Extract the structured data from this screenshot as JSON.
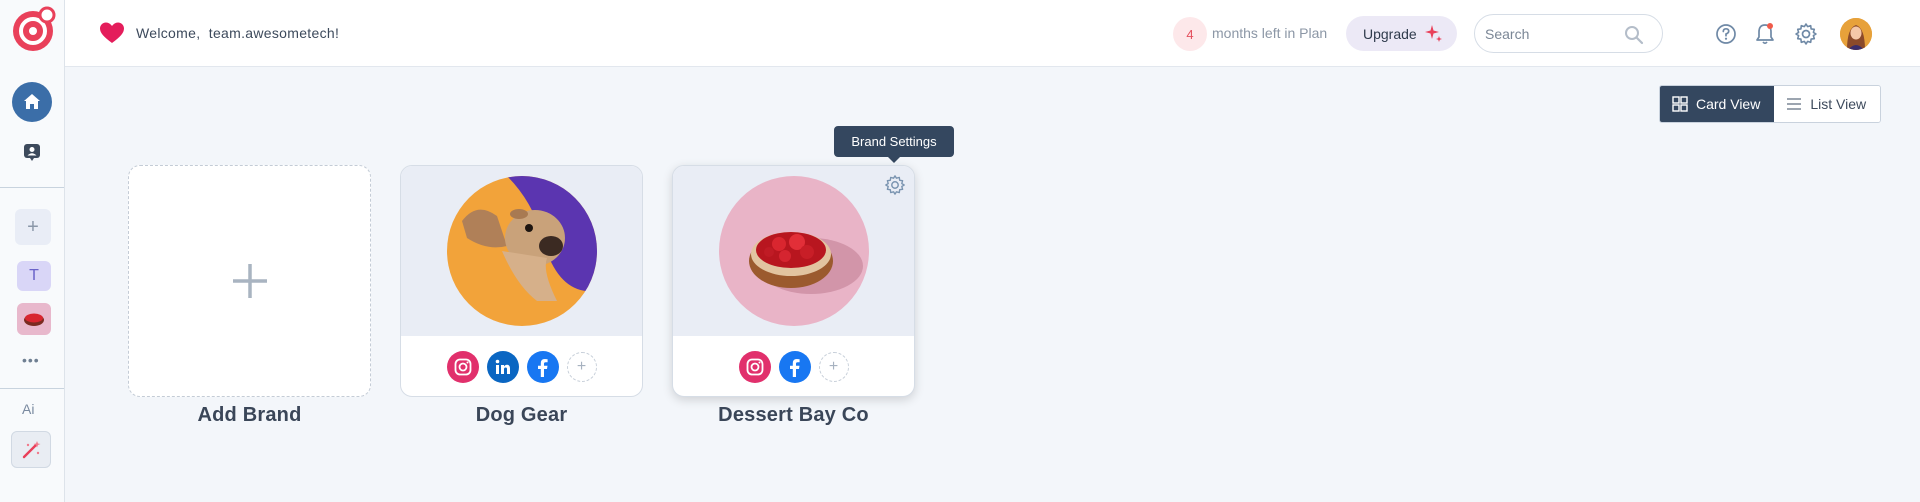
{
  "header": {
    "welcome_label": "Welcome,",
    "username": "team.awesometech!",
    "months_left": "4",
    "months_text": "months left in Plan",
    "upgrade_label": "Upgrade",
    "search_placeholder": "Search"
  },
  "sidebar": {
    "brand_initial": "T",
    "more_label": "•••",
    "ai_label": "Ai",
    "add_label": "+"
  },
  "view_toggle": {
    "card_label": "Card View",
    "list_label": "List View",
    "active": "card"
  },
  "tooltip": {
    "text": "Brand Settings"
  },
  "brands": {
    "add_label": "Add Brand",
    "items": [
      {
        "name": "Dog Gear",
        "socials": [
          "instagram",
          "linkedin",
          "facebook"
        ]
      },
      {
        "name": "Dessert Bay Co",
        "socials": [
          "instagram",
          "facebook"
        ]
      }
    ]
  },
  "colors": {
    "accent_red": "#e4405f",
    "dark_slate": "#34475f",
    "home_blue": "#3b6ea8",
    "instagram": "#e1306c",
    "linkedin": "#0a66c2",
    "facebook": "#1877f2"
  }
}
